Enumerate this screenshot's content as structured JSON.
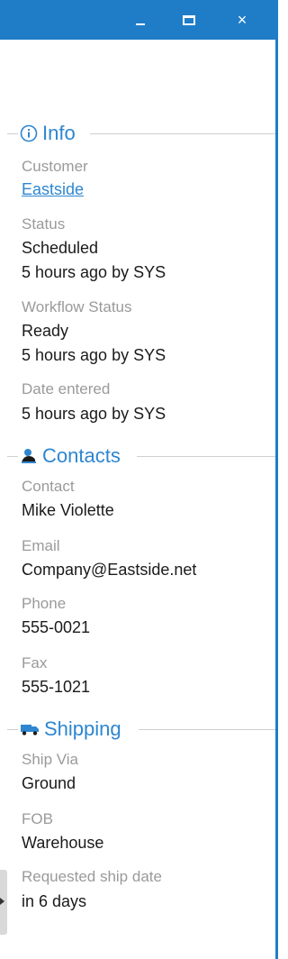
{
  "window": {
    "minimize_label": "–",
    "maximize_label": "□",
    "close_label": "×"
  },
  "info": {
    "title": "Info",
    "icon": "info-circle-icon",
    "customer_label": "Customer",
    "customer_value": "Eastside",
    "status_label": "Status",
    "status_value": "Scheduled",
    "status_meta": "5 hours ago by SYS",
    "workflow_label": "Workflow Status",
    "workflow_value": "Ready",
    "workflow_meta": "5 hours ago by SYS",
    "date_label": "Date entered",
    "date_value": "5 hours ago by SYS"
  },
  "contacts": {
    "title": "Contacts",
    "icon": "contact-person-icon",
    "contact_label": "Contact",
    "contact_value": "Mike Violette",
    "email_label": "Email",
    "email_value": "Company@Eastside.net",
    "phone_label": "Phone",
    "phone_value": "555-0021",
    "fax_label": "Fax",
    "fax_value": "555-1021"
  },
  "shipping": {
    "title": "Shipping",
    "icon": "truck-icon",
    "shipvia_label": "Ship Via",
    "shipvia_value": "Ground",
    "fob_label": "FOB",
    "fob_value": "Warehouse",
    "reqdate_label": "Requested ship date",
    "reqdate_value": "in 6 days"
  },
  "colors": {
    "accent": "#1f7dc8",
    "section_title": "#2e86d0",
    "label": "#9a9a9a"
  }
}
